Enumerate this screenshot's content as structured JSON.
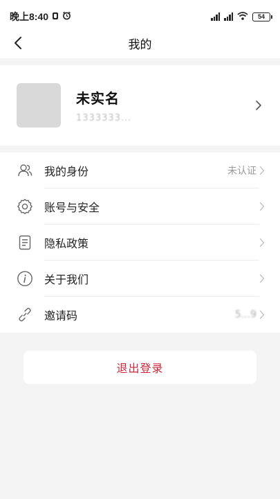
{
  "status_bar": {
    "time": "晚上8:40",
    "battery": "54"
  },
  "nav": {
    "title": "我的",
    "back_icon": "chevron-left-icon"
  },
  "profile": {
    "name": "未实名",
    "phone": "1333333..."
  },
  "menu": [
    {
      "icon": "users-icon",
      "label": "我的身份",
      "value": "未认证"
    },
    {
      "icon": "gear-icon",
      "label": "账号与安全",
      "value": ""
    },
    {
      "icon": "document-icon",
      "label": "隐私政策",
      "value": ""
    },
    {
      "icon": "info-icon",
      "label": "关于我们",
      "value": ""
    },
    {
      "icon": "link-icon",
      "label": "邀请码",
      "value": "5...9"
    }
  ],
  "logout": {
    "label": "退出登录",
    "color": "#c8283a"
  }
}
